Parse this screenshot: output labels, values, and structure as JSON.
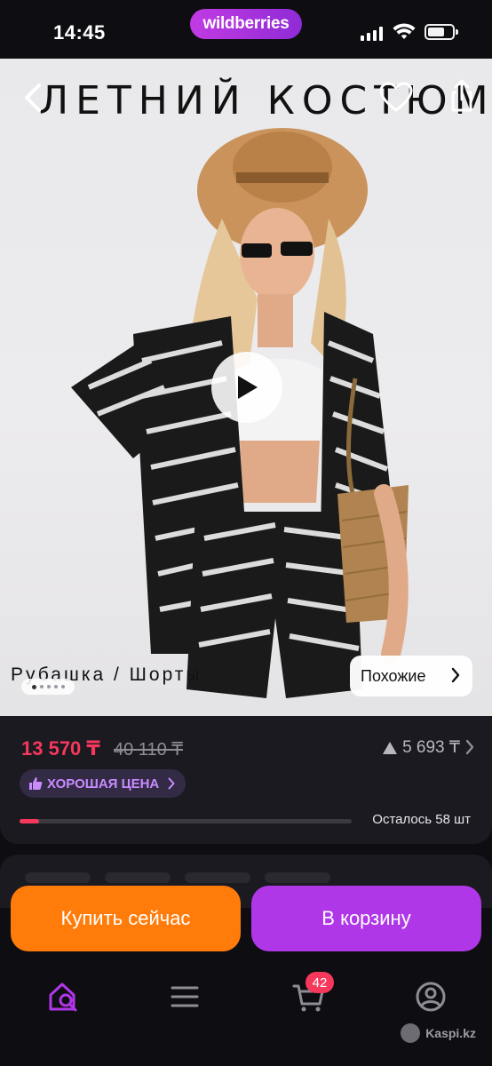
{
  "status_bar": {
    "time": "14:45",
    "brand": "wildberries"
  },
  "product": {
    "photo_title": "ЛЕТНИЙ КОСТЮМ",
    "photo_caption": "Рубашка / Шорты",
    "similar_label": "Похожие",
    "gallery_dots": 5,
    "gallery_active_index": 0
  },
  "price": {
    "current": "13 570 ₸",
    "old": "40 110 ₸",
    "right_value": "5 693 ₸",
    "badge": "ХОРОШАЯ ЦЕНА",
    "stock_text": "Осталось 58 шт",
    "stock_progress_fraction": 0.06
  },
  "actions": {
    "buy_now": "Купить сейчас",
    "add_to_cart": "В корзину"
  },
  "tab_bar": {
    "items": [
      {
        "icon": "home-search-icon",
        "active": true
      },
      {
        "icon": "menu-icon",
        "active": false
      },
      {
        "icon": "cart-icon",
        "active": false
      },
      {
        "icon": "profile-icon",
        "active": false
      }
    ],
    "cart_count": "42"
  },
  "watermark": "Kaspi.kz",
  "colors": {
    "accent": "#b037e8",
    "buy_now": "#ff7c0a",
    "price": "#f5385c",
    "badge_text": "#c88cff"
  }
}
